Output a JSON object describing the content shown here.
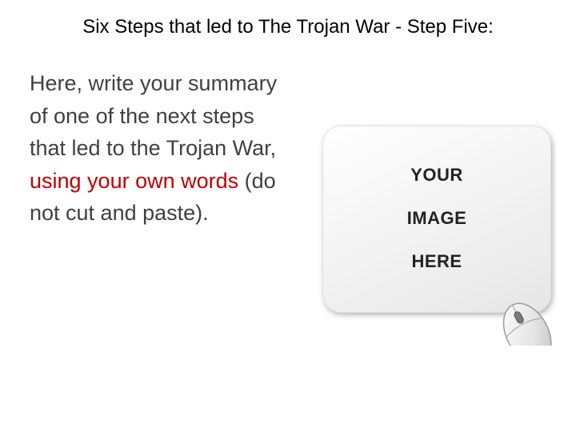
{
  "slide": {
    "title": "Six Steps that led to The Trojan War - Step Five:",
    "body": {
      "part1": "Here, write your summary of one of the next steps that led to the Trojan War, ",
      "highlight": "using your own words",
      "part2": " (do not cut and paste)."
    },
    "image": {
      "line1": "YOUR",
      "line2": "IMAGE",
      "line3": "HERE",
      "icon": "computer-mouse-icon"
    },
    "colors": {
      "text": "#404040",
      "highlight": "#c00000",
      "title": "#000000"
    }
  }
}
